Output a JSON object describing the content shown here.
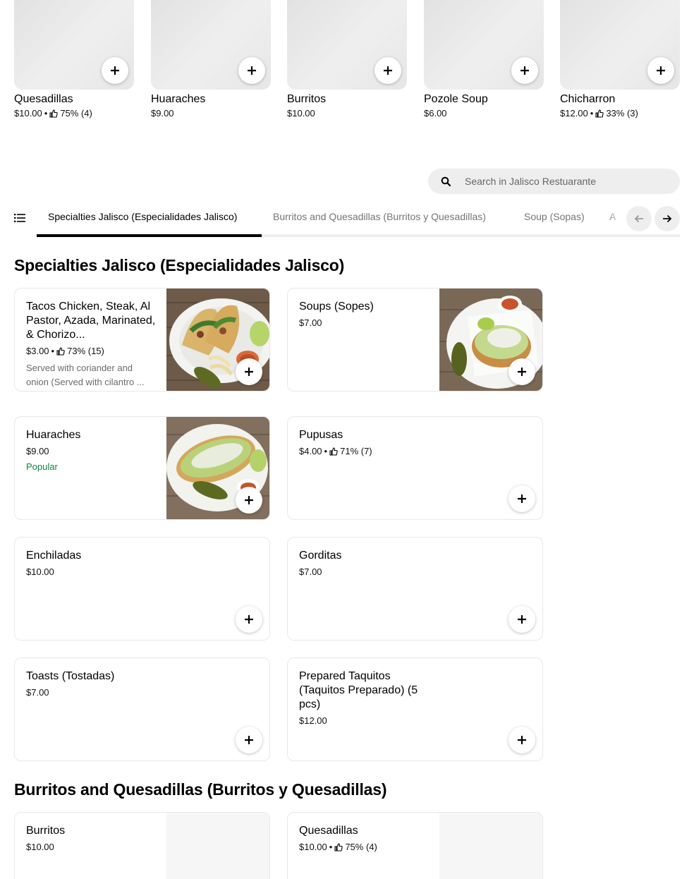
{
  "carousel": [
    {
      "name": "Quesadillas",
      "price": "$10.00",
      "sep": "•",
      "rating": "75% (4)",
      "has_rating": true
    },
    {
      "name": "Huaraches",
      "price": "$9.00",
      "has_rating": false
    },
    {
      "name": "Burritos",
      "price": "$10.00",
      "has_rating": false
    },
    {
      "name": "Pozole Soup",
      "price": "$6.00",
      "has_rating": false
    },
    {
      "name": "Chicharron",
      "price": "$12.00",
      "sep": "•",
      "rating": "33% (3)",
      "has_rating": true
    }
  ],
  "search": {
    "placeholder": "Search in Jalisco Restuarante"
  },
  "tabs": [
    {
      "label": "Specialties Jalisco (Especialidades Jalisco)",
      "active": true
    },
    {
      "label": "Burritos and Quesadillas (Burritos y Quesadillas)",
      "active": false
    },
    {
      "label": "Soup (Sopas)",
      "active": false
    },
    {
      "label": "A",
      "active": false
    }
  ],
  "sections": [
    {
      "title": "Specialties Jalisco (Especialidades Jalisco)",
      "items": [
        {
          "title": "Tacos Chicken, Steak, Al Pastor, Azada, Marinated, & Chorizo...",
          "price": "$3.00",
          "sep": "•",
          "rating": "73% (15)",
          "desc": "Served with coriander and onion (Served with cilantro ...",
          "photo": "tacos"
        },
        {
          "title": "Soups (Sopes)",
          "price": "$7.00",
          "photo": "sopes"
        },
        {
          "title": "Huaraches",
          "price": "$9.00",
          "badge": "Popular",
          "photo": "huaraches"
        },
        {
          "title": "Pupusas",
          "price": "$4.00",
          "sep": "•",
          "rating": "71% (7)"
        },
        {
          "title": "Enchiladas",
          "price": "$10.00"
        },
        {
          "title": "Gorditas",
          "price": "$7.00"
        },
        {
          "title": "Toasts (Tostadas)",
          "price": "$7.00"
        },
        {
          "title": "Prepared Taquitos (Taquitos Preparado) (5 pcs)",
          "price": "$12.00"
        }
      ]
    },
    {
      "title": "Burritos and Quesadillas (Burritos y Quesadillas)",
      "items": [
        {
          "title": "Burritos",
          "price": "$10.00"
        },
        {
          "title": "Quesadillas",
          "price": "$10.00",
          "sep": "•",
          "rating": "75% (4)"
        }
      ]
    }
  ],
  "colors": {
    "accent": "#000000",
    "popular": "#0e8345",
    "muted_text": "#757575",
    "chip_bg": "#eeeeee"
  },
  "icons": {
    "search": "search-icon",
    "menu": "list-icon",
    "add": "plus-icon",
    "thumb": "thumbs-up-icon",
    "prev": "arrow-left-icon",
    "next": "arrow-right-icon"
  }
}
